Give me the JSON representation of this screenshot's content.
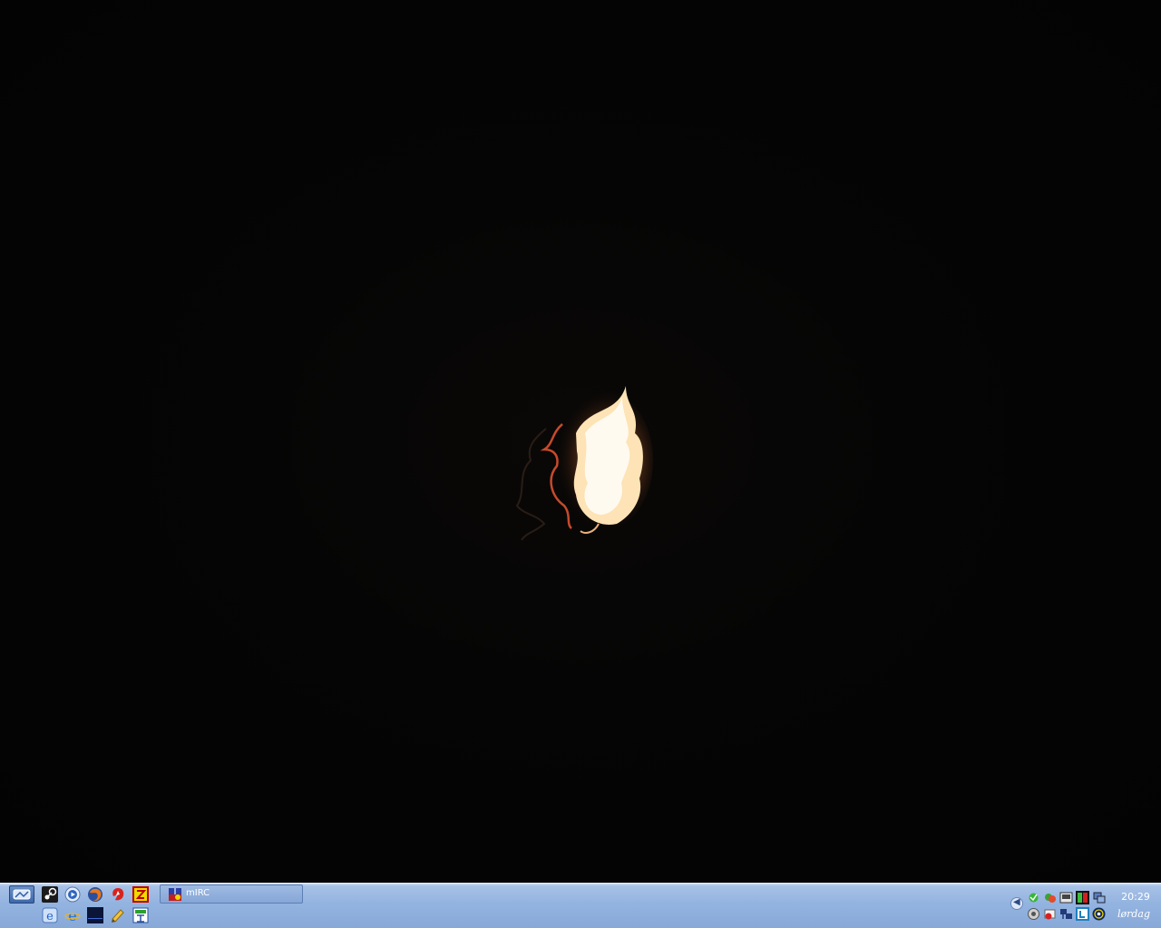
{
  "desktop": {
    "wallpaper": "flame-in-darkness-photo"
  },
  "taskbar": {
    "start_icon": "show-desktop-icon",
    "quick_launch_row1": [
      "show-desktop-icon",
      "steam-icon",
      "media-player-icon",
      "firefox-icon",
      "winamp-icon",
      "filezilla-icon"
    ],
    "quick_launch_row2": [
      "internet-explorer-icon",
      "ie-alt-icon",
      "console-icon",
      "notepad-icon",
      "app-icon"
    ],
    "tasks": [
      {
        "label": "mIRC",
        "icon": "mirc-icon"
      }
    ],
    "tray": {
      "toggle_glyph": "◀",
      "icons": [
        "network-icon",
        "messenger-icon",
        "sound-icon",
        "monitor-icon",
        "bluetooth-icon",
        "speaker-icon",
        "antivirus-icon",
        "network-connection-icon",
        "l-app-icon",
        "wifi-icon"
      ]
    },
    "clock": {
      "time": "20:29",
      "day": "lørdag"
    }
  },
  "colors": {
    "taskbar_top": "#c9dbf3",
    "taskbar_bottom": "#88a9d8",
    "desktop": "#030303"
  }
}
